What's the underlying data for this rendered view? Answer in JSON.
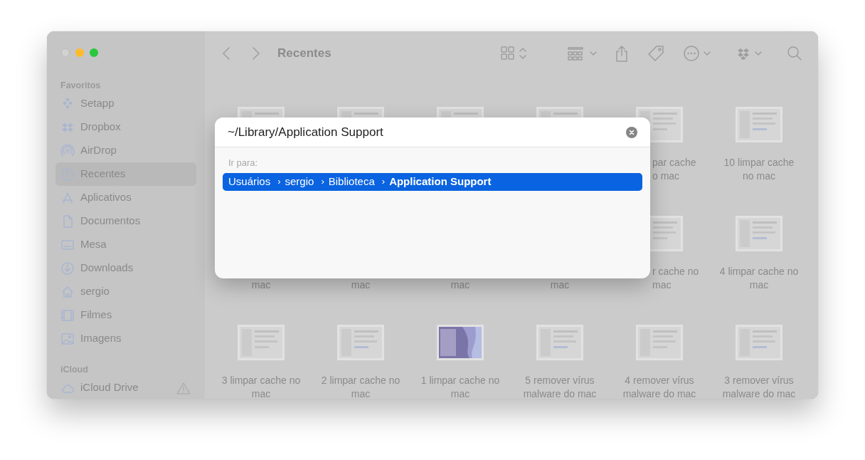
{
  "window": {
    "title": "Recentes"
  },
  "sidebar": {
    "sections": [
      {
        "title": "Favoritos",
        "items": [
          {
            "label": "Setapp",
            "selected": false
          },
          {
            "label": "Dropbox",
            "selected": false
          },
          {
            "label": "AirDrop",
            "selected": false
          },
          {
            "label": "Recentes",
            "selected": true
          },
          {
            "label": "Aplicativos",
            "selected": false
          },
          {
            "label": "Documentos",
            "selected": false
          },
          {
            "label": "Mesa",
            "selected": false
          },
          {
            "label": "Downloads",
            "selected": false
          },
          {
            "label": "sergio",
            "selected": false
          },
          {
            "label": "Filmes",
            "selected": false
          },
          {
            "label": "Imagens",
            "selected": false
          }
        ]
      },
      {
        "title": "iCloud",
        "items": [
          {
            "label": "iCloud Drive",
            "selected": false,
            "warning": true
          }
        ]
      }
    ]
  },
  "files": [
    {
      "kind": "picture"
    },
    {
      "kind": "picture"
    },
    {
      "kind": "picture"
    },
    {
      "kind": "picture"
    },
    {
      "kind": "picture",
      "lines": [
        "par cache",
        "o mac"
      ],
      "left_covered": true
    },
    {
      "kind": "picture",
      "lines": [
        "10 limpar cache",
        "no mac"
      ]
    },
    {
      "lines": [
        "mac"
      ],
      "top_covered": true
    },
    {
      "lines": [
        "mac"
      ],
      "top_covered": true
    },
    {
      "lines": [
        "mac"
      ],
      "top_covered": true
    },
    {
      "lines": [
        "mac"
      ],
      "top_covered": true
    },
    {
      "kind": "picture",
      "lines": [
        "r cache no",
        "mac"
      ],
      "left_covered": true
    },
    {
      "kind": "picture",
      "lines": [
        "4 limpar cache no",
        "mac"
      ]
    },
    {
      "kind": "picture",
      "lines": [
        "3 limpar cache no",
        "mac"
      ]
    },
    {
      "kind": "picture",
      "lines": [
        "2 limpar cache no",
        "mac"
      ]
    },
    {
      "kind": "picture",
      "lines": [
        "1 limpar cache no",
        "mac"
      ]
    },
    {
      "kind": "picture",
      "lines": [
        "5 remover vírus",
        "malware do mac"
      ]
    },
    {
      "kind": "picture",
      "lines": [
        "4 remover vírus",
        "malware do mac"
      ]
    },
    {
      "kind": "picture",
      "lines": [
        "3 remover vírus",
        "malware do mac"
      ]
    }
  ],
  "dialog": {
    "value": "~/Library/Application Support",
    "heading": "Ir para:",
    "results": [
      {
        "selected": true,
        "separator": "›",
        "path": [
          "Usuários",
          "sergio",
          "Biblioteca",
          "Application Support"
        ]
      }
    ]
  }
}
